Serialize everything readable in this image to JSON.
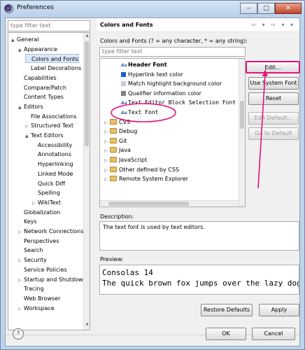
{
  "window": {
    "title": "Preferences"
  },
  "left": {
    "filter_placeholder": "type filter text",
    "tree": [
      {
        "label": "General",
        "arrow": "▲"
      },
      {
        "label": "Appearance",
        "arrow": "▲"
      },
      {
        "label": "Colors and Fonts",
        "arrow": ""
      },
      {
        "label": "Label Decorations",
        "arrow": ""
      },
      {
        "label": "Capabilities",
        "arrow": ""
      },
      {
        "label": "Compare/Patch",
        "arrow": ""
      },
      {
        "label": "Content Types",
        "arrow": ""
      },
      {
        "label": "Editors",
        "arrow": "▲"
      },
      {
        "label": "File Associations",
        "arrow": ""
      },
      {
        "label": "Structured Text",
        "arrow": "▷"
      },
      {
        "label": "Text Editors",
        "arrow": "▲"
      },
      {
        "label": "Accessibility",
        "arrow": ""
      },
      {
        "label": "Annotations",
        "arrow": ""
      },
      {
        "label": "Hyperlinking",
        "arrow": ""
      },
      {
        "label": "Linked Mode",
        "arrow": ""
      },
      {
        "label": "Quick Diff",
        "arrow": ""
      },
      {
        "label": "Spelling",
        "arrow": ""
      },
      {
        "label": "WikiText",
        "arrow": "▷"
      },
      {
        "label": "Globalization",
        "arrow": ""
      },
      {
        "label": "Keys",
        "arrow": ""
      },
      {
        "label": "Network Connections",
        "arrow": "▷"
      },
      {
        "label": "Perspectives",
        "arrow": ""
      },
      {
        "label": "Search",
        "arrow": ""
      },
      {
        "label": "Security",
        "arrow": "▷"
      },
      {
        "label": "Service Policies",
        "arrow": ""
      },
      {
        "label": "Startup and Shutdown",
        "arrow": "▷"
      },
      {
        "label": "Tracing",
        "arrow": ""
      },
      {
        "label": "Web Browser",
        "arrow": ""
      },
      {
        "label": "Workspace",
        "arrow": "▷"
      }
    ]
  },
  "right": {
    "title": "Colors and Fonts",
    "nav": "⇦ ▾ ⇨ ▾ ▾",
    "label": "Colors and Fonts (? = any character, * = any string):",
    "filter_placeholder": "type filter text",
    "font_items": [
      {
        "label": "Header Font",
        "kind": "font",
        "bold": true
      },
      {
        "label": "Hyperlink text color",
        "kind": "color",
        "color": "#1a5fd8"
      },
      {
        "label": "Match highlight background color",
        "kind": "color",
        "color": "#c9c9e8"
      },
      {
        "label": "Qualifier information color",
        "kind": "color",
        "color": "#808080"
      },
      {
        "label": "Text Editor Block Selection Font",
        "kind": "font-mono"
      },
      {
        "label": "Text Font",
        "kind": "font-mono"
      },
      {
        "label": "CVS",
        "kind": "folder"
      },
      {
        "label": "Debug",
        "kind": "folder"
      },
      {
        "label": "Git",
        "kind": "folder"
      },
      {
        "label": "Java",
        "kind": "folder"
      },
      {
        "label": "JavaScript",
        "kind": "folder"
      },
      {
        "label": "Other defined by CSS",
        "kind": "folder"
      },
      {
        "label": "Remote System Explorer",
        "kind": "folder"
      }
    ],
    "buttons": {
      "edit": "Edit...",
      "use_system_font": "Use System Font",
      "reset": "Reset",
      "edit_default": "Edit Default...",
      "go_to_default": "Go to Default"
    },
    "description_label": "Description:",
    "description": "The text font is used by text editors.",
    "preview_label": "Preview:",
    "preview_lines": [
      "Consolas 14",
      "The quick brown fox jumps over the lazy dog."
    ],
    "restore_defaults": "Restore Defaults",
    "apply": "Apply"
  },
  "footer": {
    "help": "?",
    "ok": "OK",
    "cancel": "Cancel"
  },
  "colors": {
    "highlight": "#e5127c"
  }
}
